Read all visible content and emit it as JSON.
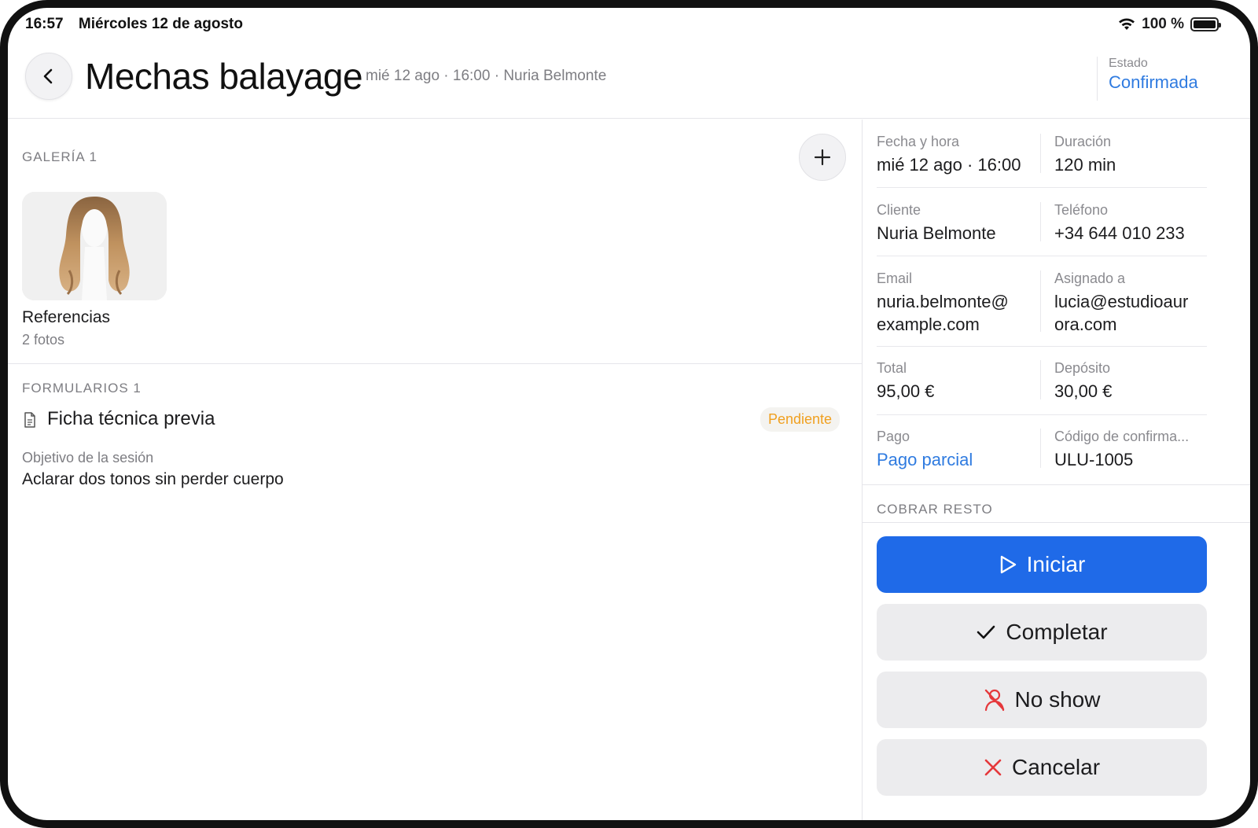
{
  "status_bar": {
    "time": "16:57",
    "date": "Miércoles 12 de agosto",
    "battery": "100 %"
  },
  "header": {
    "title": "Mechas balayage",
    "subtitle": "mié 12 ago · 16:00 · Nuria Belmonte",
    "status_label": "Estado",
    "status_value": "Confirmada"
  },
  "gallery": {
    "label": "GALERÍA  1",
    "album": {
      "name": "Referencias",
      "count": "2 fotos"
    }
  },
  "forms": {
    "label": "FORMULARIOS  1",
    "item": {
      "name": "Ficha técnica previa",
      "badge": "Pendiente"
    },
    "field": {
      "label": "Objetivo de la sesión",
      "value": "Aclarar dos tonos sin perder cuerpo"
    }
  },
  "details": [
    {
      "label": "Fecha y hora",
      "value": "mié 12 ago · 16:00"
    },
    {
      "label": "Duración",
      "value": "120 min"
    },
    {
      "label": "Cliente",
      "value": "Nuria Belmonte"
    },
    {
      "label": "Teléfono",
      "value": "+34 644 010 233"
    },
    {
      "label": "Email",
      "value": "nuria.belmonte@ example.com"
    },
    {
      "label": "Asignado a",
      "value": "lucia@estudioaur ora.com"
    },
    {
      "label": "Total",
      "value": "95,00 €"
    },
    {
      "label": "Depósito",
      "value": "30,00 €"
    },
    {
      "label": "Pago",
      "value": "Pago parcial"
    },
    {
      "label": "Código de confirma...",
      "value": "ULU-1005"
    }
  ],
  "cobrar_label": "COBRAR RESTO",
  "actions": {
    "start": "Iniciar",
    "complete": "Completar",
    "no_show": "No show",
    "cancel": "Cancelar"
  },
  "colors": {
    "accent": "#2f7be0",
    "primary_button": "#1f6ae8",
    "pending": "#f0a020",
    "danger": "#e5383b"
  }
}
